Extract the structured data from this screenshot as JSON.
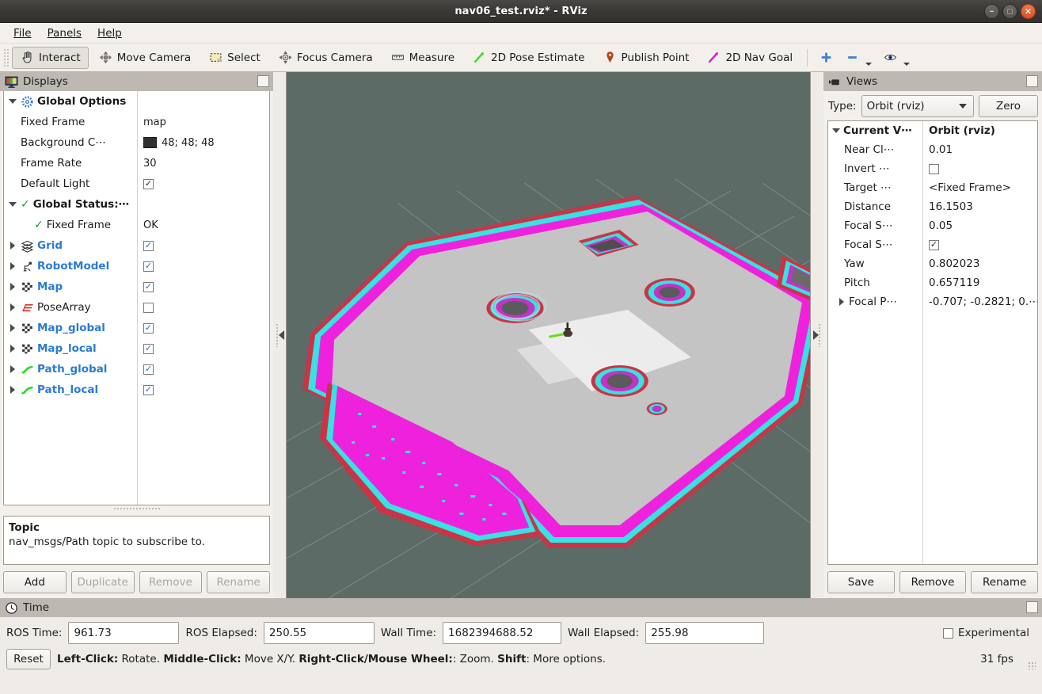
{
  "window": {
    "title": "nav06_test.rviz* - RViz",
    "buttons": {
      "minimize": "–",
      "maximize": "□",
      "close": "×"
    }
  },
  "menubar": {
    "items": [
      "File",
      "Panels",
      "Help"
    ]
  },
  "toolbar": {
    "items": [
      {
        "label": "Interact",
        "icon": "hand-cursor-icon",
        "checked": true
      },
      {
        "label": "Move Camera",
        "icon": "move-camera-icon",
        "checked": false
      },
      {
        "label": "Select",
        "icon": "select-rectangle-icon",
        "checked": false
      },
      {
        "label": "Focus Camera",
        "icon": "focus-camera-icon",
        "checked": false
      },
      {
        "label": "Measure",
        "icon": "ruler-icon",
        "checked": false
      },
      {
        "label": "2D Pose Estimate",
        "icon": "green-arrow-icon",
        "checked": false
      },
      {
        "label": "Publish Point",
        "icon": "map-pin-icon",
        "checked": false
      },
      {
        "label": "2D Nav Goal",
        "icon": "magenta-arrow-icon",
        "checked": false
      }
    ],
    "extras": [
      {
        "icon": "plus-icon",
        "name": "add-tool-button"
      },
      {
        "icon": "minus-icon",
        "name": "remove-tool-button"
      },
      {
        "icon": "eye-icon",
        "name": "visibility-button"
      }
    ]
  },
  "displays": {
    "title": "Displays",
    "rows": [
      {
        "indent": 0,
        "arrow": "down",
        "icon": "gear-icon",
        "label": "Global Options",
        "style": "bold",
        "value_type": "none"
      },
      {
        "indent": 1,
        "arrow": "none",
        "icon": "",
        "label": "Fixed Frame",
        "style": "plain",
        "value_type": "text",
        "value": "map"
      },
      {
        "indent": 1,
        "arrow": "none",
        "icon": "",
        "label": "Background C⋯",
        "style": "plain",
        "value_type": "color",
        "value": "48; 48; 48",
        "color": "#303030"
      },
      {
        "indent": 1,
        "arrow": "none",
        "icon": "",
        "label": "Frame Rate",
        "style": "plain",
        "value_type": "text",
        "value": "30"
      },
      {
        "indent": 1,
        "arrow": "none",
        "icon": "",
        "label": "Default Light",
        "style": "plain",
        "value_type": "check",
        "checked": true
      },
      {
        "indent": 0,
        "arrow": "down",
        "icon": "green-check-icon",
        "label": "Global Status:⋯",
        "style": "bold",
        "value_type": "none"
      },
      {
        "indent": 2,
        "arrow": "none",
        "icon": "green-check-icon",
        "label": "Fixed Frame",
        "style": "plain",
        "value_type": "text",
        "value": "OK"
      },
      {
        "indent": 0,
        "arrow": "right",
        "icon": "grid-icon",
        "label": "Grid",
        "style": "blue",
        "value_type": "check",
        "checked": true
      },
      {
        "indent": 0,
        "arrow": "right",
        "icon": "robot-icon",
        "label": "RobotModel",
        "style": "blue",
        "value_type": "check",
        "checked": true
      },
      {
        "indent": 0,
        "arrow": "right",
        "icon": "map-icon",
        "label": "Map",
        "style": "blue",
        "value_type": "check",
        "checked": true
      },
      {
        "indent": 0,
        "arrow": "right",
        "icon": "posearray-icon",
        "label": "PoseArray",
        "style": "plain",
        "value_type": "check",
        "checked": false
      },
      {
        "indent": 0,
        "arrow": "right",
        "icon": "map-icon",
        "label": "Map_global",
        "style": "blue",
        "value_type": "check",
        "checked": true
      },
      {
        "indent": 0,
        "arrow": "right",
        "icon": "map-icon",
        "label": "Map_local",
        "style": "blue",
        "value_type": "check",
        "checked": true
      },
      {
        "indent": 0,
        "arrow": "right",
        "icon": "path-icon",
        "label": "Path_global",
        "style": "blue",
        "value_type": "check",
        "checked": true
      },
      {
        "indent": 0,
        "arrow": "right",
        "icon": "path-icon",
        "label": "Path_local",
        "style": "blue",
        "value_type": "check",
        "checked": true
      }
    ],
    "description": {
      "title": "Topic",
      "text": "nav_msgs/Path topic to subscribe to."
    },
    "buttons": [
      {
        "label": "Add",
        "enabled": true
      },
      {
        "label": "Duplicate",
        "enabled": false
      },
      {
        "label": "Remove",
        "enabled": false
      },
      {
        "label": "Rename",
        "enabled": false
      }
    ]
  },
  "views": {
    "title": "Views",
    "type_label": "Type:",
    "type_value": "Orbit (rviz)",
    "zero_label": "Zero",
    "rows": [
      {
        "indent": 0,
        "arrow": "down",
        "label": "Current V⋯",
        "bold": true,
        "value_type": "text",
        "value": "Orbit (rviz)"
      },
      {
        "indent": 1,
        "arrow": "none",
        "label": "Near Cl⋯",
        "bold": false,
        "value_type": "text",
        "value": "0.01"
      },
      {
        "indent": 1,
        "arrow": "none",
        "label": "Invert ⋯",
        "bold": false,
        "value_type": "check",
        "checked": false
      },
      {
        "indent": 1,
        "arrow": "none",
        "label": "Target ⋯",
        "bold": false,
        "value_type": "text",
        "value": "<Fixed Frame>"
      },
      {
        "indent": 1,
        "arrow": "none",
        "label": "Distance",
        "bold": false,
        "value_type": "text",
        "value": "16.1503"
      },
      {
        "indent": 1,
        "arrow": "none",
        "label": "Focal S⋯",
        "bold": false,
        "value_type": "text",
        "value": "0.05"
      },
      {
        "indent": 1,
        "arrow": "none",
        "label": "Focal S⋯",
        "bold": false,
        "value_type": "check",
        "checked": true
      },
      {
        "indent": 1,
        "arrow": "none",
        "label": "Yaw",
        "bold": false,
        "value_type": "text",
        "value": "0.802023"
      },
      {
        "indent": 1,
        "arrow": "none",
        "label": "Pitch",
        "bold": false,
        "value_type": "text",
        "value": "0.657119"
      },
      {
        "indent": 1,
        "arrow": "right",
        "label": "Focal P⋯",
        "bold": false,
        "value_type": "text",
        "value": "-0.707; -0.2821; 0.⋯"
      }
    ],
    "buttons": [
      {
        "label": "Save"
      },
      {
        "label": "Remove"
      },
      {
        "label": "Rename"
      }
    ]
  },
  "time": {
    "title": "Time",
    "fields": [
      {
        "label": "ROS Time:",
        "value": "961.73"
      },
      {
        "label": "ROS Elapsed:",
        "value": "250.55"
      },
      {
        "label": "Wall Time:",
        "value": "1682394688.52"
      },
      {
        "label": "Wall Elapsed:",
        "value": "255.98"
      }
    ],
    "experimental_label": "Experimental",
    "experimental_checked": false,
    "reset_label": "Reset",
    "hint_parts": [
      {
        "text": "Left-Click:",
        "bold": true
      },
      {
        "text": " Rotate. ",
        "bold": false
      },
      {
        "text": "Middle-Click:",
        "bold": true
      },
      {
        "text": " Move X/Y. ",
        "bold": false
      },
      {
        "text": "Right-Click/Mouse Wheel:",
        "bold": true
      },
      {
        "text": ": Zoom. ",
        "bold": false
      },
      {
        "text": "Shift",
        "bold": true
      },
      {
        "text": ": More options.",
        "bold": false
      }
    ],
    "fps": "31 fps"
  },
  "viewport": {
    "background_color": "#5d6b67",
    "grid_color": "#9aa6a2",
    "map_free_color": "#c6c6c6",
    "map_light_color": "#ececec",
    "costmap_lethal_color": "#ff00ff",
    "costmap_inflation_color": "#36e2e2",
    "costmap_boundary_color": "#cc3344",
    "robot_color": "#4a3a2a",
    "robot_arrow_color": "#66dd22"
  },
  "colors": {
    "accent_blue": "#2b7bd4",
    "panel_bg": "#f3f0ec",
    "titlebar_bg": "#3a3835",
    "close_btn": "#e2572c"
  }
}
